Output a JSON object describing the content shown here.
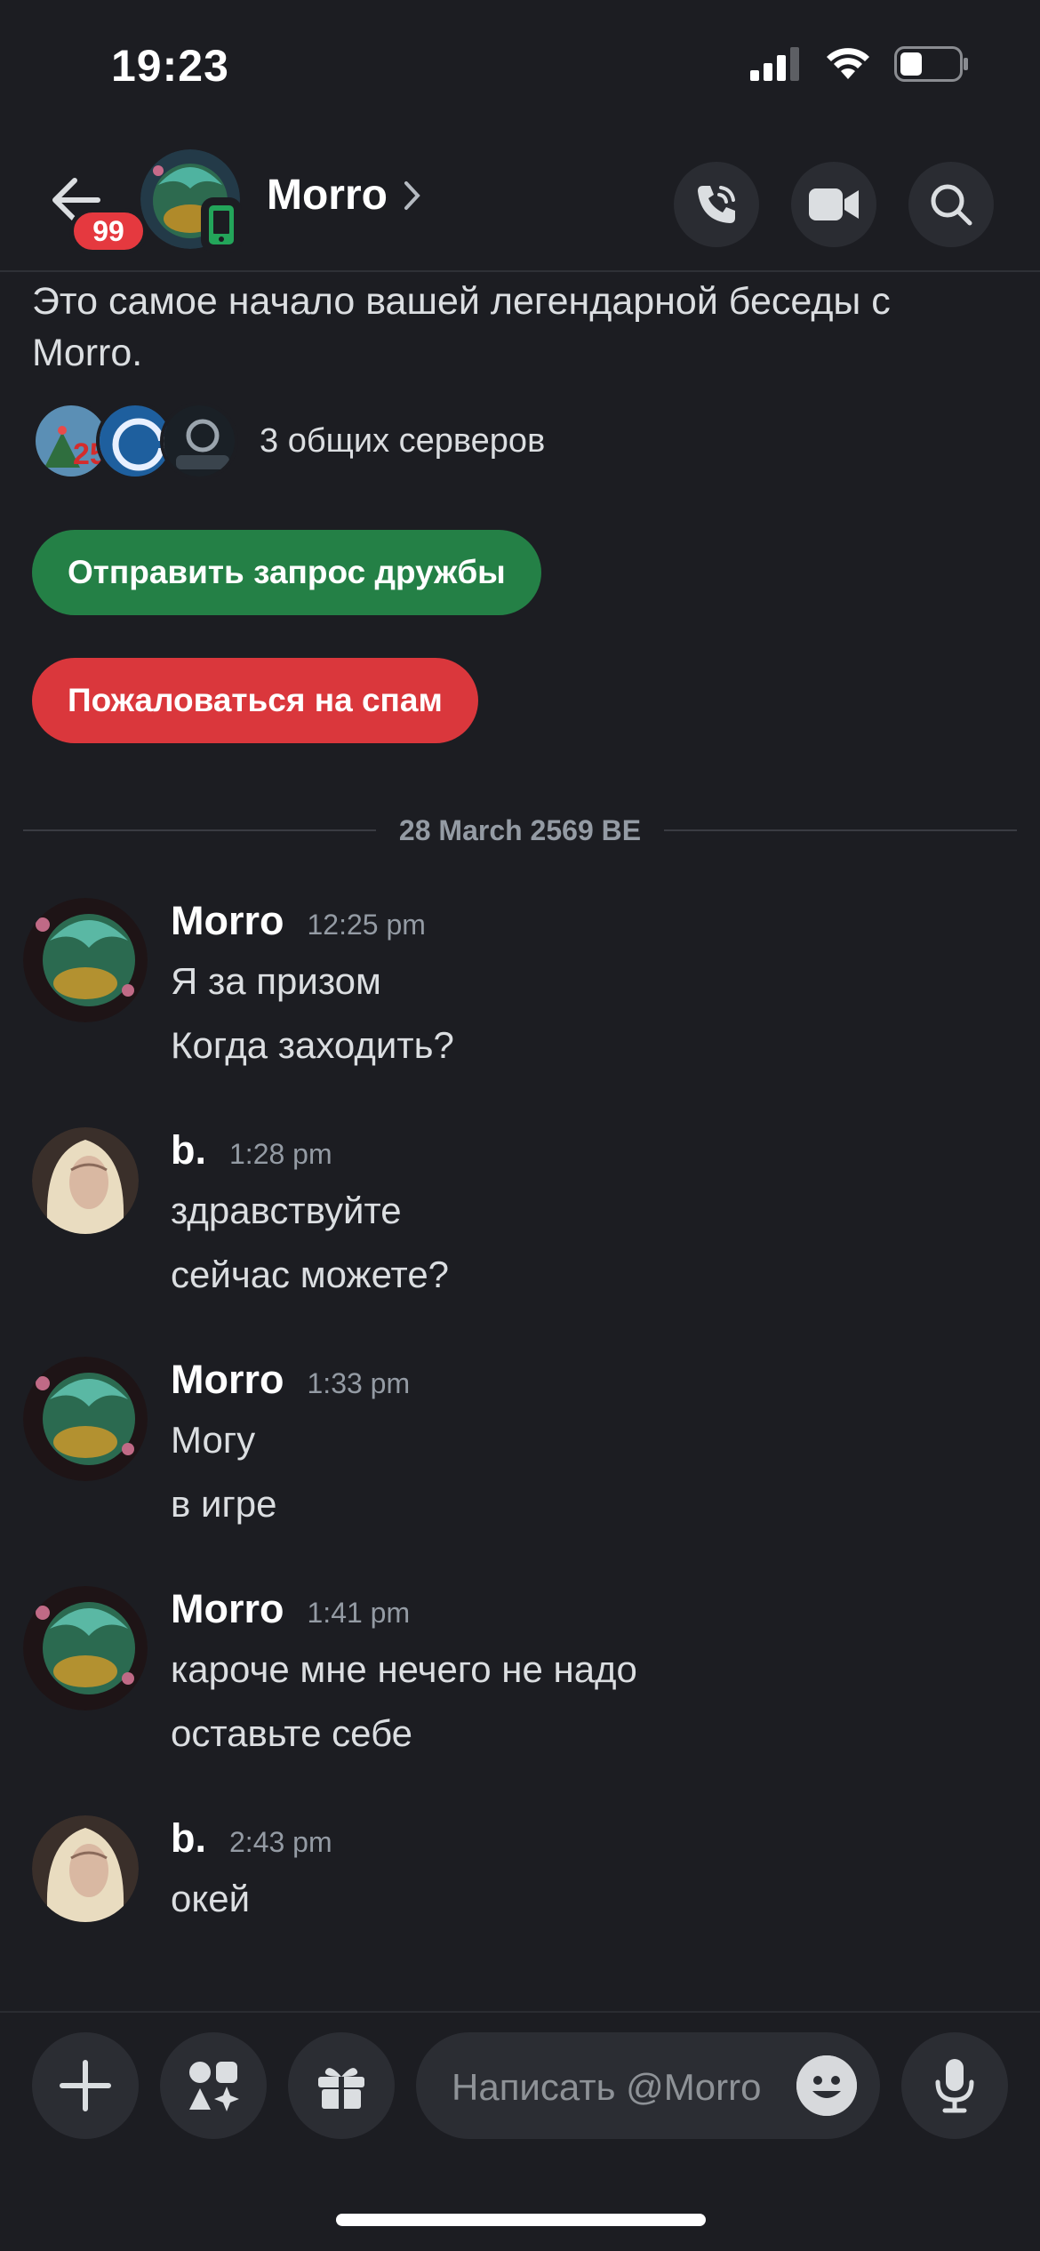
{
  "status_bar": {
    "time": "19:23"
  },
  "header": {
    "unread_count": "99",
    "contact_name": "Morro"
  },
  "intro": {
    "text": "Это самое начало вашей легендарной беседы с Morro.",
    "mutual_servers": "3 общих серверов",
    "friend_request_label": "Отправить запрос дружбы",
    "report_spam_label": "Пожаловаться на спам"
  },
  "date_divider": "28 March 2569 BE",
  "messages": [
    {
      "author": "Morro",
      "time": "12:25 pm",
      "lines": [
        "Я за призом",
        "Когда заходить?"
      ]
    },
    {
      "author": "b.",
      "time": "1:28 pm",
      "lines": [
        "здравствуйте",
        "сейчас можете?"
      ]
    },
    {
      "author": "Morro",
      "time": "1:33 pm",
      "lines": [
        "Могу",
        "в игре"
      ]
    },
    {
      "author": "Morro",
      "time": "1:41 pm",
      "lines": [
        "кароче мне нечего не надо",
        "оставьте себе"
      ]
    },
    {
      "author": "b.",
      "time": "2:43 pm",
      "lines": [
        "окей"
      ]
    }
  ],
  "composer": {
    "placeholder": "Написать @Morro"
  },
  "colors": {
    "background": "#1c1d22",
    "friend_button": "#248046",
    "spam_button": "#da373c",
    "badge": "#e5393f",
    "online_mobile": "#23a55a"
  },
  "icons": [
    "back-arrow-icon",
    "mobile-status-icon",
    "chevron-right-icon",
    "phone-call-icon",
    "video-camera-icon",
    "search-icon",
    "plus-icon",
    "apps-icon",
    "gift-icon",
    "emoji-icon",
    "microphone-icon"
  ]
}
